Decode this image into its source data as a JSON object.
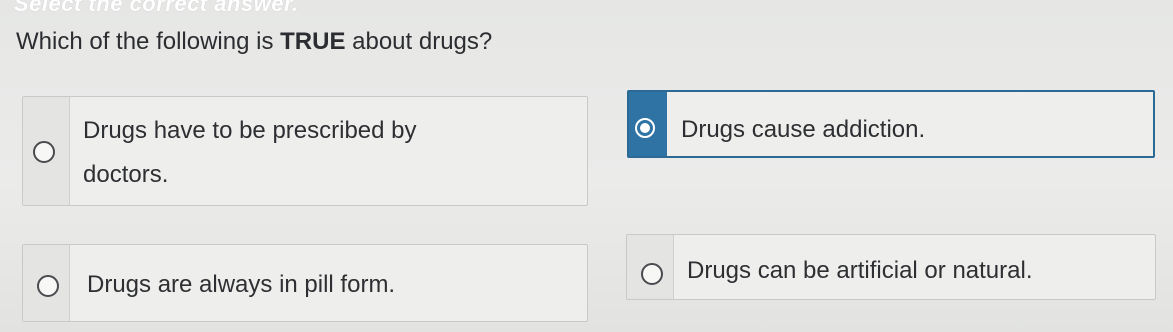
{
  "instruction": "Select the correct answer.",
  "question": {
    "prefix": "Which of the following is ",
    "emphasis": "TRUE",
    "suffix": " about drugs?"
  },
  "options": [
    {
      "label_line1": "Drugs have to be prescribed by",
      "label_line2": "doctors.",
      "selected": false
    },
    {
      "label": "Drugs cause addiction.",
      "selected": true
    },
    {
      "label": "Drugs are always in pill form.",
      "selected": false
    },
    {
      "label": "Drugs can be artificial or natural.",
      "selected": false
    }
  ],
  "colors": {
    "selected_accent": "#2f73a4",
    "option_background": "#eeeeec",
    "page_background": "#e8e9e7"
  }
}
